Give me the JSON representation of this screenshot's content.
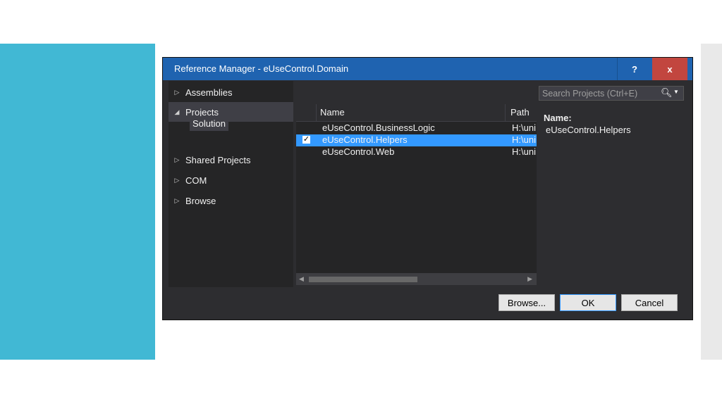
{
  "window": {
    "title": "Reference Manager - eUseControl.Domain",
    "help_label": "?",
    "close_label": "x"
  },
  "sidebar": {
    "items": [
      {
        "label": "Assemblies",
        "arrow": "▷"
      },
      {
        "label": "Projects",
        "arrow": "◢"
      },
      {
        "label": "Shared Projects",
        "arrow": "▷"
      },
      {
        "label": "COM",
        "arrow": "▷"
      },
      {
        "label": "Browse",
        "arrow": "▷"
      }
    ],
    "sub_item": "Solution"
  },
  "search": {
    "placeholder": "Search Projects (Ctrl+E)",
    "icon": "search-icon"
  },
  "list": {
    "columns": [
      "Name",
      "Path"
    ],
    "rows": [
      {
        "name": "eUseControl.BusinessLogic",
        "path": "H:\\uni",
        "checked": false
      },
      {
        "name": "eUseControl.Helpers",
        "path": "H:\\uni",
        "checked": true
      },
      {
        "name": "eUseControl.Web",
        "path": "H:\\uni",
        "checked": false
      }
    ]
  },
  "details": {
    "name_label": "Name:",
    "name_value": "eUseControl.Helpers"
  },
  "buttons": {
    "browse": "Browse...",
    "ok": "OK",
    "cancel": "Cancel"
  },
  "colors": {
    "title_bar": "#1f63b0",
    "close": "#c2463f",
    "selection": "#3399ff",
    "slide_accent": "#41b8d4"
  }
}
